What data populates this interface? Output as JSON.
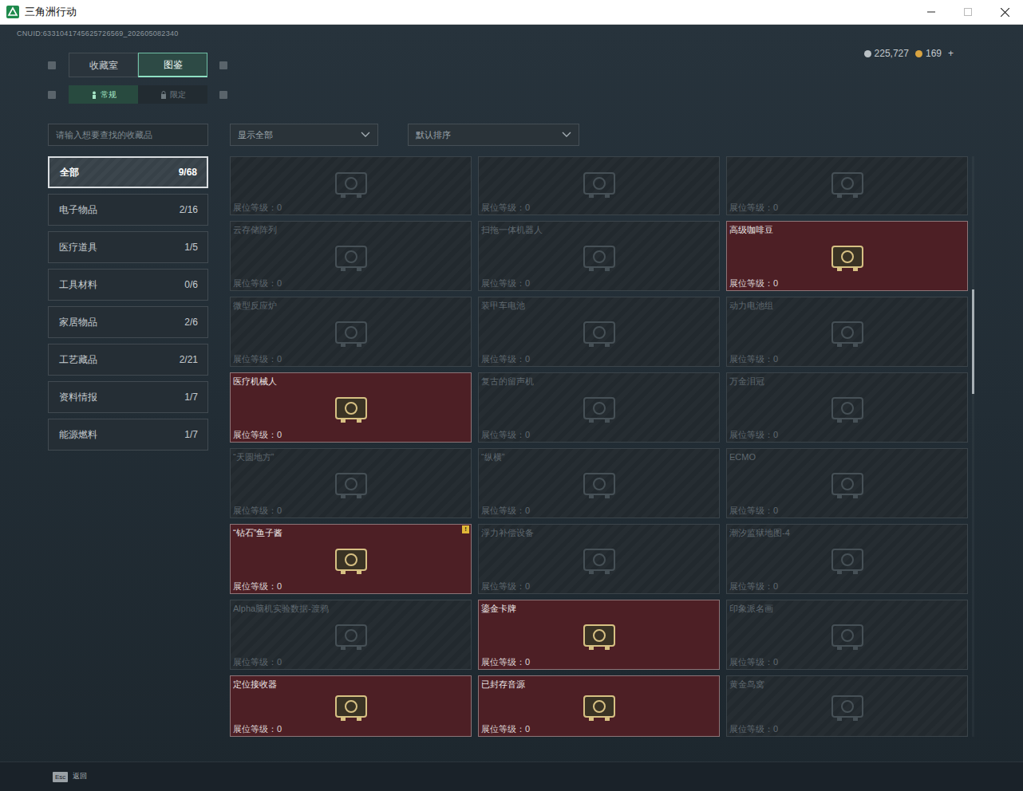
{
  "window": {
    "title": "三角洲行动"
  },
  "account": {
    "uid": "CNUID:6331041745625726569_202605082340"
  },
  "currency": [
    {
      "amount": "225,727",
      "color": "#b9c0c4"
    },
    {
      "amount": "169",
      "color": "#d9a441"
    }
  ],
  "currency_add": "+",
  "tabs": [
    {
      "label": "收藏室",
      "selected": false
    },
    {
      "label": "图鉴",
      "selected": true
    }
  ],
  "subtabs": [
    {
      "label": "常规",
      "selected": true
    },
    {
      "label": "限定",
      "selected": false
    }
  ],
  "search": {
    "placeholder": "请输入想要查找的收藏品"
  },
  "filters": [
    {
      "value": "显示全部"
    },
    {
      "value": "默认排序"
    }
  ],
  "categories": [
    {
      "label": "全部",
      "count": "9/68",
      "selected": true
    },
    {
      "label": "电子物品",
      "count": "2/16",
      "selected": false
    },
    {
      "label": "医疗道具",
      "count": "1/5",
      "selected": false
    },
    {
      "label": "工具材料",
      "count": "0/6",
      "selected": false
    },
    {
      "label": "家居物品",
      "count": "2/6",
      "selected": false
    },
    {
      "label": "工艺藏品",
      "count": "2/21",
      "selected": false
    },
    {
      "label": "资料情报",
      "count": "1/7",
      "selected": false
    },
    {
      "label": "能源燃料",
      "count": "1/7",
      "selected": false
    }
  ],
  "items": [
    {
      "kind": "top-cut",
      "owned": false,
      "level": "展位等级：0"
    },
    {
      "kind": "top-cut",
      "owned": false,
      "level": "展位等级：0"
    },
    {
      "kind": "top-cut",
      "owned": false,
      "level": "展位等级：0"
    },
    {
      "kind": "full",
      "name": "云存储阵列",
      "owned": false,
      "level": "展位等级：0"
    },
    {
      "kind": "full",
      "name": "扫拖一体机器人",
      "owned": false,
      "level": "展位等级：0"
    },
    {
      "kind": "full",
      "name": "高级咖啡豆",
      "owned": true,
      "level": "展位等级：0"
    },
    {
      "kind": "full",
      "name": "微型反应炉",
      "owned": false,
      "level": "展位等级：0"
    },
    {
      "kind": "full",
      "name": "装甲车电池",
      "owned": false,
      "level": "展位等级：0"
    },
    {
      "kind": "full",
      "name": "动力电池组",
      "owned": false,
      "level": "展位等级：0"
    },
    {
      "kind": "full",
      "name": "医疗机械人",
      "owned": true,
      "level": "展位等级：0"
    },
    {
      "kind": "full",
      "name": "复古的留声机",
      "owned": false,
      "level": "展位等级：0"
    },
    {
      "kind": "full",
      "name": "万金泪冠",
      "owned": false,
      "level": "展位等级：0"
    },
    {
      "kind": "full",
      "name": "“天圆地方”",
      "owned": false,
      "level": "展位等级：0"
    },
    {
      "kind": "full",
      "name": "“纵横”",
      "owned": false,
      "level": "展位等级：0"
    },
    {
      "kind": "full",
      "name": "ECMO",
      "owned": false,
      "level": "展位等级：0"
    },
    {
      "kind": "full",
      "name": "“钻石”鱼子酱",
      "owned": true,
      "level": "展位等级：0",
      "badge": "!"
    },
    {
      "kind": "full",
      "name": "浮力补偿设备",
      "owned": false,
      "level": "展位等级：0"
    },
    {
      "kind": "full",
      "name": "潮汐监狱地图-4",
      "owned": false,
      "level": "展位等级：0"
    },
    {
      "kind": "full",
      "name": "Alpha脑机实验数据-渡鸦",
      "owned": false,
      "level": "展位等级：0"
    },
    {
      "kind": "full",
      "name": "鎏金卡牌",
      "owned": true,
      "level": "展位等级：0"
    },
    {
      "kind": "full",
      "name": "印象派名画",
      "owned": false,
      "level": "展位等级：0"
    },
    {
      "kind": "bottom-cut",
      "name": "定位接收器",
      "owned": true,
      "level": "展位等级：0"
    },
    {
      "kind": "bottom-cut",
      "name": "已封存音源",
      "owned": true,
      "level": "展位等级：0"
    },
    {
      "kind": "bottom-cut",
      "name": "黄金鸟窝",
      "owned": false,
      "level": "展位等级：0"
    }
  ],
  "scrollbar": {
    "offset": 0.23,
    "level": 0.18
  },
  "footer": {
    "key": "Esc",
    "label": "返回"
  }
}
